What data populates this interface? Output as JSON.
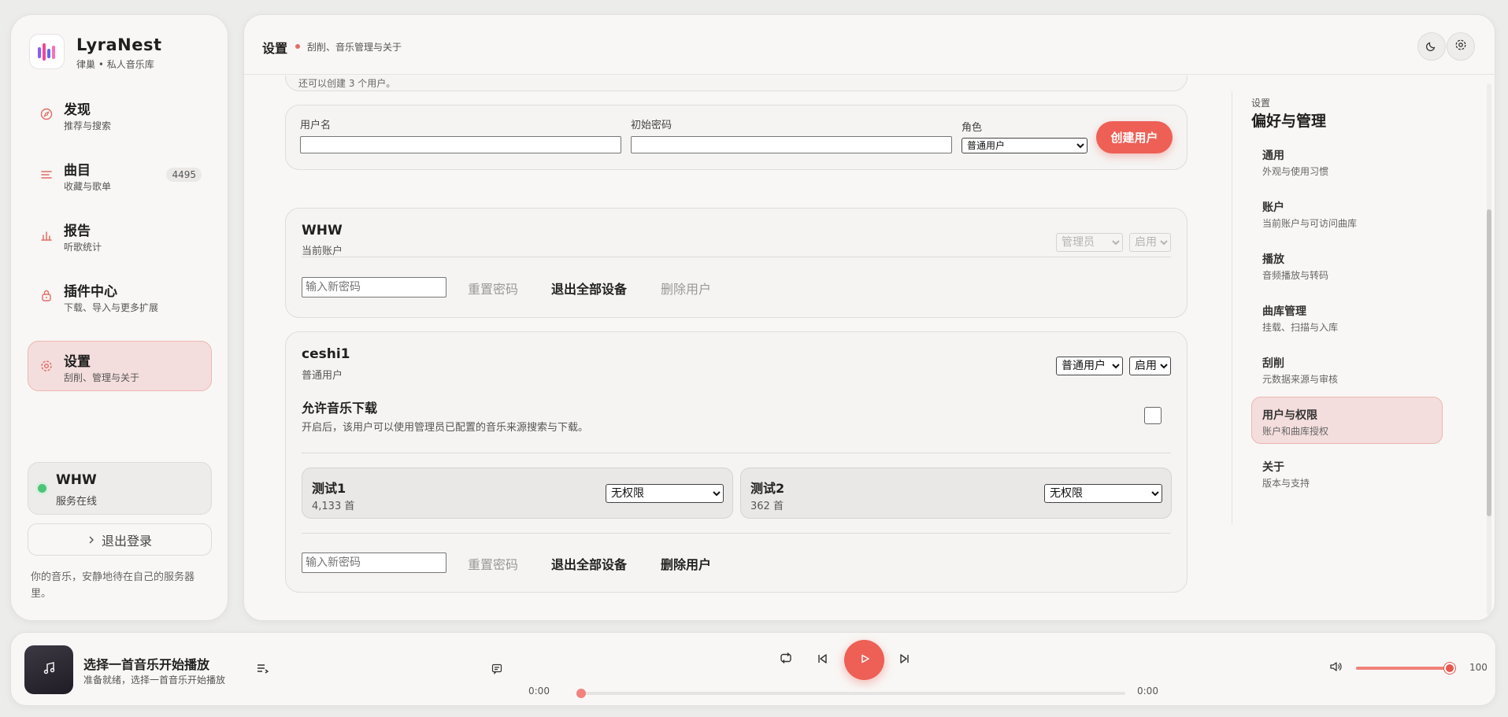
{
  "app": {
    "name": "LyraNest",
    "subtitle": "律巢 • 私人音乐库"
  },
  "sidebar": {
    "items": [
      {
        "title": "发现",
        "sub": "推荐与搜索",
        "icon": "compass-icon"
      },
      {
        "title": "曲目",
        "sub": "收藏与歌单",
        "icon": "list-icon",
        "badge": "4495"
      },
      {
        "title": "报告",
        "sub": "听歌统计",
        "icon": "bar-chart-icon"
      },
      {
        "title": "插件中心",
        "sub": "下载、导入与更多扩展",
        "icon": "plugin-icon"
      },
      {
        "title": "设置",
        "sub": "刮削、管理与关于",
        "icon": "gear-icon",
        "active": true
      }
    ],
    "status": {
      "name": "WHW",
      "text": "服务在线"
    },
    "logout_label": "退出登录",
    "tagline": "你的音乐，安静地待在自己的服务器里。"
  },
  "header": {
    "title": "设置",
    "subtitle": "刮削、音乐管理与关于"
  },
  "content": {
    "truncated_note": "还可以创建 3 个用户。",
    "create": {
      "username_label": "用户名",
      "username_value": "",
      "password_label": "初始密码",
      "password_value": "",
      "role_label": "角色",
      "role_value": "普通用户",
      "submit_label": "创建用户"
    },
    "users": [
      {
        "name": "WHW",
        "role_text": "当前账户",
        "role_select": "管理员",
        "status_select": "启用",
        "disabled": true,
        "password_placeholder": "输入新密码",
        "reset_label": "重置密码",
        "logout_all_label": "退出全部设备",
        "delete_label": "删除用户"
      },
      {
        "name": "ceshi1",
        "role_text": "普通用户",
        "role_select": "普通用户",
        "status_select": "启用",
        "disabled": false,
        "download_title": "允许音乐下载",
        "download_desc": "开启后，该用户可以使用管理员已配置的音乐来源搜索与下载。",
        "download_enabled": false,
        "libraries": [
          {
            "name": "测试1",
            "count": "4,133 首",
            "permission": "无权限"
          },
          {
            "name": "测试2",
            "count": "362 首",
            "permission": "无权限"
          }
        ],
        "password_placeholder": "输入新密码",
        "reset_label": "重置密码",
        "logout_all_label": "退出全部设备",
        "delete_label": "删除用户"
      }
    ]
  },
  "settings_nav": {
    "eyebrow": "设置",
    "title": "偏好与管理",
    "items": [
      {
        "title": "通用",
        "sub": "外观与使用习惯"
      },
      {
        "title": "账户",
        "sub": "当前账户与可访问曲库"
      },
      {
        "title": "播放",
        "sub": "音频播放与转码"
      },
      {
        "title": "曲库管理",
        "sub": "挂载、扫描与入库"
      },
      {
        "title": "刮削",
        "sub": "元数据来源与审核"
      },
      {
        "title": "用户与权限",
        "sub": "账户和曲库授权",
        "active": true
      },
      {
        "title": "关于",
        "sub": "版本与支持"
      }
    ]
  },
  "player": {
    "title": "选择一首音乐开始播放",
    "subtitle": "准备就绪，选择一首音乐开始播放",
    "time_current": "0:00",
    "time_total": "0:00",
    "progress": 0,
    "volume": "100",
    "volume_level": 1.0
  },
  "colors": {
    "accent": "#ee5f55",
    "active_bg": "#f4dedd",
    "online": "#4ec47a"
  }
}
